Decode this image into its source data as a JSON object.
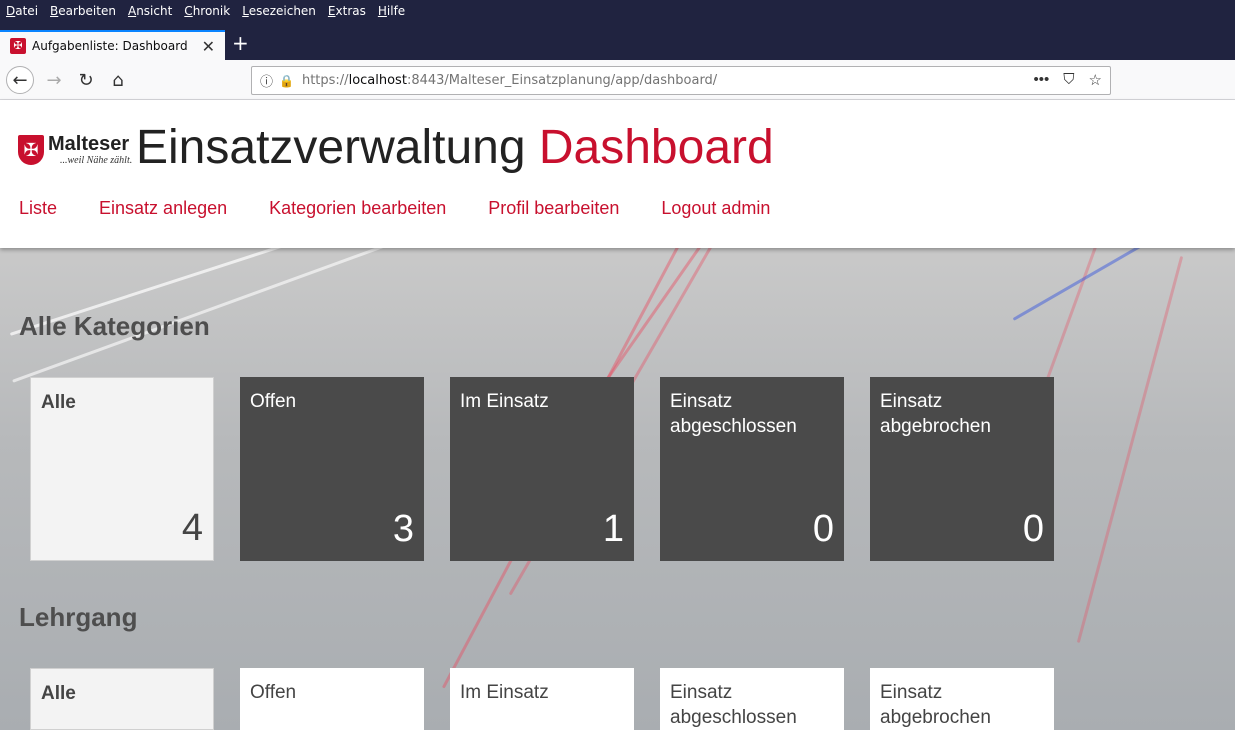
{
  "browser": {
    "menu": [
      "Datei",
      "Bearbeiten",
      "Ansicht",
      "Chronik",
      "Lesezeichen",
      "Extras",
      "Hilfe"
    ],
    "tab_title": "Aufgabenliste: Dashboard",
    "url_prefix": "https://",
    "url_host": "localhost",
    "url_rest": ":8443/Malteser_Einsatzplanung/app/dashboard/"
  },
  "header": {
    "logo_name": "Malteser",
    "logo_tagline": "...weil Nähe zählt.",
    "title_main": "Einsatzverwaltung",
    "title_accent": "Dashboard",
    "nav": [
      "Liste",
      "Einsatz anlegen",
      "Kategorien bearbeiten",
      "Profil bearbeiten",
      "Logout admin"
    ]
  },
  "sections": [
    {
      "title": "Alle Kategorien",
      "cards": [
        {
          "label": "Alle",
          "count": "4"
        },
        {
          "label": "Offen",
          "count": "3"
        },
        {
          "label": "Im Einsatz",
          "count": "1"
        },
        {
          "label": "Einsatz abgeschlossen",
          "count": "0"
        },
        {
          "label": "Einsatz abgebrochen",
          "count": "0"
        }
      ]
    },
    {
      "title": "Lehrgang",
      "cards": [
        {
          "label": "Alle"
        },
        {
          "label": "Offen"
        },
        {
          "label": "Im Einsatz"
        },
        {
          "label": "Einsatz abgeschlossen"
        },
        {
          "label": "Einsatz abgebrochen"
        }
      ]
    }
  ],
  "colors": {
    "accent": "#c8102e",
    "dark_card": "#4a4a4a",
    "light_card": "#f3f3f3"
  }
}
